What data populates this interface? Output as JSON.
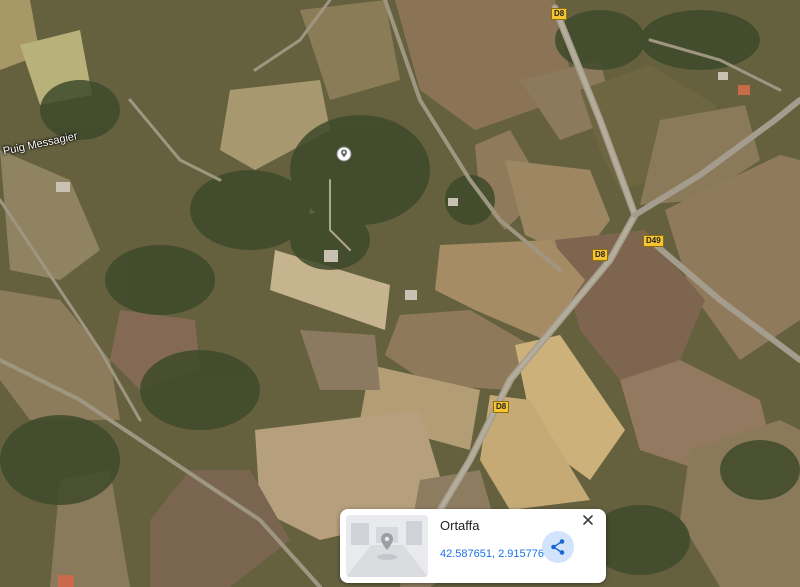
{
  "map": {
    "place_labels": {
      "puig": "Puig Messagier"
    },
    "road_badges": {
      "d8_top": "D8",
      "d8_mid": "D8",
      "d49": "D49",
      "d8_bottom": "D8"
    },
    "badge_color": "#f6c431"
  },
  "info_card": {
    "title": "Ortaffa",
    "coordinates": "42.587651, 2.915776",
    "accent_color": "#1a73e8",
    "icons": [
      "close-icon",
      "share-icon",
      "location-pin-icon"
    ]
  }
}
